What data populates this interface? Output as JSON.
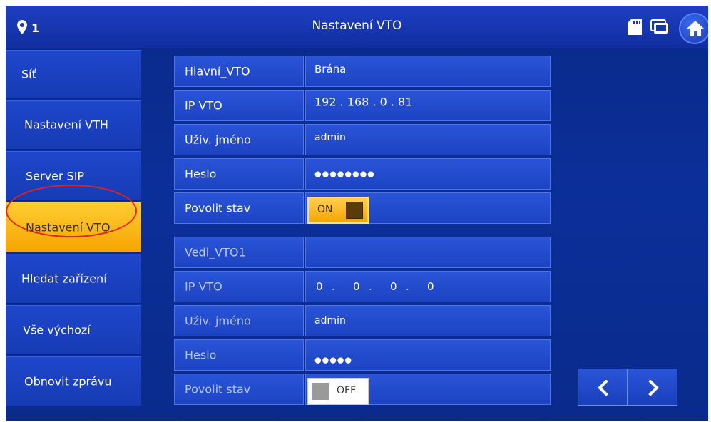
{
  "header": {
    "title": "Nastavení VTO",
    "location_count": "1"
  },
  "sidebar": {
    "items": [
      {
        "label": "Síť"
      },
      {
        "label": "Nastavení VTH"
      },
      {
        "label": "Server SIP"
      },
      {
        "label": "Nastavení VTO"
      },
      {
        "label": "Hledat zařízení"
      },
      {
        "label": "Vše výchozí"
      },
      {
        "label": "Obnovit zprávu"
      }
    ],
    "active_index": 3
  },
  "main_vto": {
    "name_label": "Hlavní_VTO",
    "name_value": "Brána",
    "ip_label": "IP VTO",
    "ip_value": "192 . 168 . 0 . 81",
    "user_label": "Uživ. jméno",
    "user_value": "admin",
    "password_label": "Heslo",
    "password_value": "●●●●●●●●",
    "enable_label": "Povolit stav",
    "enable_state": "ON"
  },
  "secondary_vto": {
    "name_label": "Vedl_VTO1",
    "name_value": "",
    "ip_label": "IP VTO",
    "ip_octets": [
      "0",
      "0",
      "0",
      "0"
    ],
    "user_label": "Uživ. jméno",
    "user_value": "admin",
    "password_label": "Heslo",
    "password_value": "●●●●●",
    "enable_label": "Povolit stav",
    "enable_state": "OFF"
  },
  "colors": {
    "background": "#0a2a8a",
    "active_item": "#f5a400",
    "annotation": "#e8201a"
  }
}
